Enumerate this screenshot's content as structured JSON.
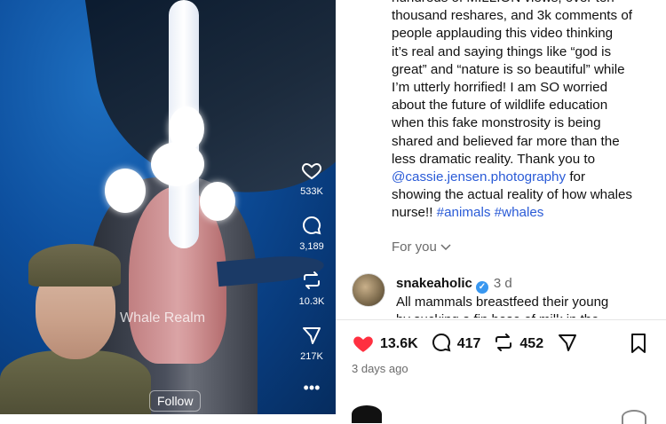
{
  "video": {
    "watermark": "Whale Realm",
    "follow_label": "Follow",
    "rail": {
      "likes": "533K",
      "comments": "3,189",
      "reposts": "10.3K",
      "shares": "217K"
    }
  },
  "caption": {
    "lines": [
      "hundreds of MILLION views, over ten",
      "thousand reshares, and 3k comments of",
      "people applauding this video thinking",
      "it’s real and saying things like “god is",
      "great” and “nature is so beautiful” while",
      "I’m utterly horrified! I am SO worried",
      "about the future of wildlife education",
      "when this fake monstrosity is being",
      "shared and believed far more than the",
      "less dramatic reality. Thank you to"
    ],
    "mention": "@cassie.jensen.photography",
    "after_mention": " for",
    "line_last": "showing the actual reality of how whales",
    "nurse_text": "nurse!! ",
    "tag1": "#animals",
    "tag2": "#whales"
  },
  "for_you": "For you",
  "comment": {
    "username": "snakeaholic",
    "time": "3 d",
    "text": "All mammals breastfeed their young",
    "text_partial": "by sucking a fin hose of milk in the"
  },
  "actions": {
    "likes": "13.6K",
    "comments": "417",
    "reposts": "452"
  },
  "post_date": "3 days ago",
  "colors": {
    "like_red": "#ff3040",
    "link_blue": "#2a5bd7"
  }
}
